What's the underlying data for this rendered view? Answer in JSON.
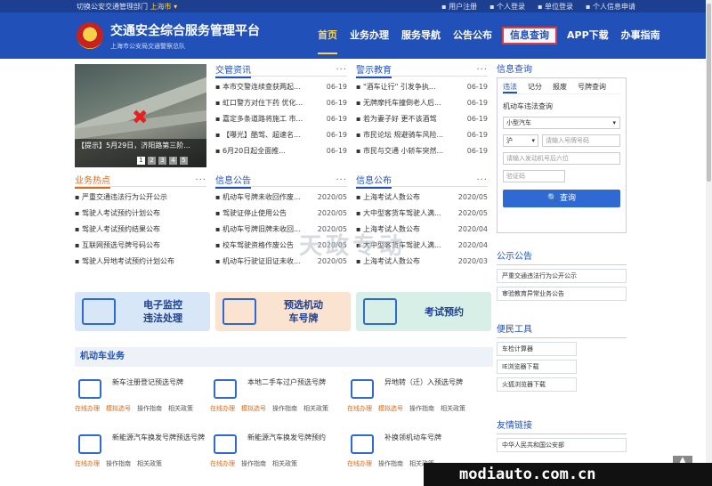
{
  "topbar": {
    "switch_text": "切换公安交通管理部门",
    "city": "上海市 ▾",
    "links": [
      "▪ 用户注册",
      "▪ 个人登录",
      "▪ 单位登录",
      "▪ 个人信息申请"
    ]
  },
  "header": {
    "title": "交通安全综合服务管理平台",
    "subtitle": "上海市公安局交通警察总队"
  },
  "nav": [
    "首页",
    "业务办理",
    "服务导航",
    "公告公布",
    "信息查询",
    "APP下载",
    "办事指南"
  ],
  "photo": {
    "caption": "【提示】5月29日，济阳路第三阶...",
    "pages": [
      "1",
      "2",
      "3",
      "4",
      "5"
    ]
  },
  "news": {
    "title": "交管资讯",
    "more": "···",
    "items": [
      {
        "t": "▪ 本市交警连续查获两起...",
        "d": "06-19"
      },
      {
        "t": "▪ 虹口警方对住下药 优化...",
        "d": "06-19"
      },
      {
        "t": "▪ 嘉定多条道路将施工 市...",
        "d": "06-19"
      },
      {
        "t": "▪ 【曝光】酷驾、超速名...",
        "d": "06-19"
      },
      {
        "t": "▪ 6月20日起全面推...",
        "d": "06-19"
      }
    ]
  },
  "warn": {
    "title": "警示教育",
    "more": "···",
    "items": [
      {
        "t": "▪ \"酒车让行\" 引发争执...",
        "d": "06-19"
      },
      {
        "t": "▪ 无牌摩托车撞倒老人后...",
        "d": "06-19"
      },
      {
        "t": "▪ 若为妻子好 更不该酒驾",
        "d": "06-19"
      },
      {
        "t": "▪ 市民论坛 规避骑车风险...",
        "d": "06-19"
      },
      {
        "t": "▪ 市民与交通 小轿车突然...",
        "d": "06-19"
      }
    ]
  },
  "hot": {
    "title": "业务热点",
    "more": "···",
    "items": [
      {
        "t": "▪ 严重交通违法行为公开公示",
        "d": ""
      },
      {
        "t": "▪ 驾驶人考试预约计划公布",
        "d": ""
      },
      {
        "t": "▪ 驾驶人考试预约结果公布",
        "d": ""
      },
      {
        "t": "▪ 互联网预选号牌号码公布",
        "d": ""
      },
      {
        "t": "▪ 驾驶人异地考试预约计划公布",
        "d": ""
      }
    ]
  },
  "announce": {
    "title": "信息公告",
    "more": "···",
    "items": [
      {
        "t": "▪ 机动车号牌未收回作废...",
        "d": "2020/05"
      },
      {
        "t": "▪ 驾驶证停止使用公告",
        "d": "2020/05"
      },
      {
        "t": "▪ 机动车号牌旧牌未收回...",
        "d": "2020/05"
      },
      {
        "t": "▪ 校车驾驶资格作废公告",
        "d": "2020/05"
      },
      {
        "t": "▪ 机动车行驶证旧证未收...",
        "d": "2020/05"
      }
    ]
  },
  "publish": {
    "title": "信息公布",
    "more": "···",
    "items": [
      {
        "t": "▪ 上海考试人数公布",
        "d": "2020/05"
      },
      {
        "t": "▪ 大中型客货车驾驶人满...",
        "d": "2020/05"
      },
      {
        "t": "▪ 上海考试人数公布",
        "d": "2020/04"
      },
      {
        "t": "▪ 大中型客货车驾驶人满...",
        "d": "2020/04"
      },
      {
        "t": "▪ 上海考试人数公布",
        "d": "2020/03"
      }
    ]
  },
  "cards": [
    {
      "line1": "电子监控",
      "line2": "违法处理"
    },
    {
      "line1": "预选机动",
      "line2": "车号牌"
    },
    {
      "line1": "考试预约",
      "line2": ""
    }
  ],
  "section_title": "机动车业务",
  "biz": [
    {
      "name": "新车注册登记预选号牌",
      "links": [
        "在线办理",
        "模拟选号",
        "操作指南",
        "相关政策"
      ]
    },
    {
      "name": "本地二手车过户预选号牌",
      "links": [
        "在线办理",
        "模拟选号",
        "操作指南",
        "相关政策"
      ]
    },
    {
      "name": "异地转（迁）入预选号牌",
      "links": [
        "在线办理",
        "模拟选号",
        "操作指南",
        "相关政策"
      ]
    },
    {
      "name": "新能源汽车换发号牌预选号牌",
      "links": [
        "在线办理",
        "操作指南",
        "相关政策"
      ]
    },
    {
      "name": "新能源汽车换发号牌预约",
      "links": [
        "在线办理",
        "操作指南",
        "相关政策"
      ]
    },
    {
      "name": "补换领机动车号牌",
      "links": [
        "在线办理",
        "操作指南",
        "相关政策"
      ]
    }
  ],
  "query": {
    "title": "信息查询",
    "tabs": [
      "违法",
      "记分",
      "报废",
      "号牌查询"
    ],
    "sub": "机动车违法查询",
    "vehicle_type": "小型汽车",
    "province": "沪",
    "plate_placeholder": "请输入号牌号码",
    "engine_placeholder": "请输入发动机号后六位",
    "captcha_placeholder": "验证码",
    "button": "🔍 查询"
  },
  "notice": {
    "title": "公示公告",
    "items": [
      "严重交通违法行为公开公示",
      "审验教育异常业务公告"
    ]
  },
  "tools": {
    "title": "便民工具",
    "items": [
      "车检计算器",
      "IE浏览器下载",
      "火狐浏览器下载"
    ]
  },
  "links": {
    "title": "友情链接",
    "items": [
      "中华人民共和国公安部"
    ]
  },
  "watermark": "天政专动",
  "footer": "modiauto.com.cn",
  "colors": {
    "brand": "#2151b8",
    "accent": "#e06a1a",
    "highlight": "#e03a3a"
  }
}
